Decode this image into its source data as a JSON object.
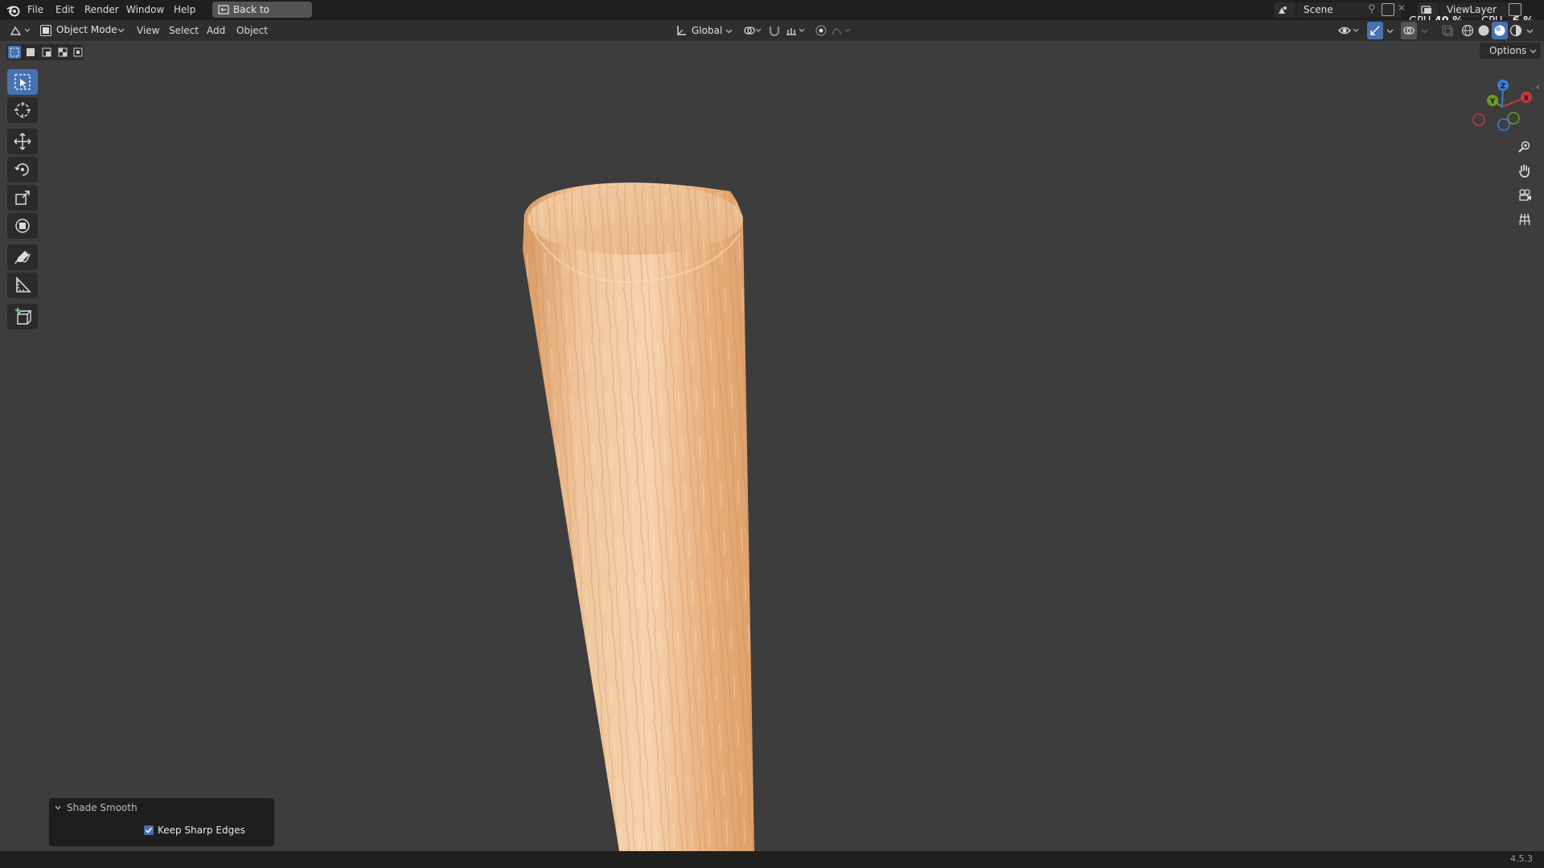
{
  "menubar": {
    "items": [
      "File",
      "Edit",
      "Render",
      "Window",
      "Help"
    ],
    "back_button": "Back to Previous"
  },
  "header": {
    "mode": "Object Mode",
    "menus": [
      "View",
      "Select",
      "Add",
      "Object"
    ],
    "orientation": "Global",
    "options_label": "Options"
  },
  "scene": {
    "label": "Scene"
  },
  "view_layer": {
    "label": "ViewLayer"
  },
  "stats": {
    "gpu_label": "GPU",
    "gpu_value": "40 %",
    "cpu_label": "CPU",
    "cpu_value": "6 %"
  },
  "gizmo": {
    "x": "X",
    "y": "Y",
    "z": "Z"
  },
  "operator_panel": {
    "title": "Shade Smooth",
    "keep_sharp_edges_label": "Keep Sharp Edges",
    "keep_sharp_edges_checked": true
  },
  "status": {
    "version": "4.5.3"
  },
  "colors": {
    "accent": "#4772b3",
    "axis_x": "#c8383f",
    "axis_y": "#6e9b23",
    "axis_z": "#3a7fd6",
    "wood": "#e9b88a"
  },
  "tools": [
    "select-box-icon",
    "cursor-icon",
    "move-icon",
    "rotate-icon",
    "scale-icon",
    "transform-icon",
    "annotate-icon",
    "measure-icon",
    "add-cube-icon"
  ]
}
